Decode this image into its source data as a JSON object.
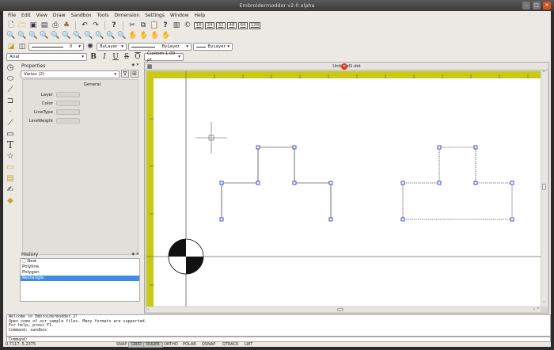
{
  "window": {
    "title": "Embroidermodder v2.0 alpha"
  },
  "menu": [
    "File",
    "Edit",
    "View",
    "Draw",
    "Sandbox",
    "Tools",
    "Dimension",
    "Settings",
    "Window",
    "Help"
  ],
  "toolbar": {
    "row1_icons": [
      "new-icon",
      "open-icon",
      "save-icon",
      "save-as-icon",
      "print-icon",
      "design-details-icon",
      "undo-icon",
      "redo-icon",
      "help-icon",
      "cut-icon",
      "copy-icon",
      "paste-icon",
      "whats-this-icon",
      "tip-of-day-icon",
      "about-icon"
    ],
    "text_sizes": [
      "16",
      "24",
      "32",
      "48",
      "64",
      "128"
    ],
    "row2_icons": [
      "zoom-realtime-icon",
      "zoom-previous-icon",
      "zoom-window-icon",
      "zoom-dynamic-icon",
      "zoom-scale-icon",
      "zoom-center-icon",
      "zoom-in-icon",
      "zoom-out-icon",
      "zoom-selected-icon",
      "zoom-all-icon",
      "zoom-extents-icon",
      "pan-realtime-icon",
      "pan-point-icon",
      "pan-left-icon",
      "pan-right-icon"
    ],
    "linetype_value": "0",
    "color_value": "ByLayer",
    "linetype2_value": "ByLayer",
    "lineweight_value": "ByLayer",
    "font_value": "Arial",
    "text_style": [
      "B",
      "I",
      "U",
      "S",
      "O"
    ],
    "text_size_value": "Custom 1.00 pt"
  },
  "properties": {
    "title": "Properties",
    "selector_value": "Varies (2)",
    "section": "General",
    "rows": [
      "Layer",
      "Color",
      "LineType",
      "LineWeight"
    ]
  },
  "history": {
    "title": "History",
    "items": [
      "New",
      "Polyline",
      "Polygon",
      "Rectangle"
    ],
    "selected_index": 3
  },
  "document": {
    "title": "Untitled1.dst"
  },
  "console": {
    "lines": [
      "Welcome to Embroidermodder 2!",
      "Open some of our sample files. Many formats are supported.",
      "For help, press F1.",
      "Command: sandbox"
    ],
    "prompt": "Command:"
  },
  "status": {
    "coords": "0.7117, 5.2375",
    "buttons": [
      {
        "label": "SNAP",
        "on": false
      },
      {
        "label": "GRID",
        "on": true
      },
      {
        "label": "RULER",
        "on": true
      },
      {
        "label": "ORTHO",
        "on": false
      },
      {
        "label": "POLAR",
        "on": false
      },
      {
        "label": "QSNAP",
        "on": false
      },
      {
        "label": "QTRACK",
        "on": false
      },
      {
        "label": "LWT",
        "on": false
      }
    ]
  },
  "colors": {
    "ruler": "#c9c918",
    "selection_grip": "#2a3ad8",
    "history_selected": "#3d8ee0"
  }
}
